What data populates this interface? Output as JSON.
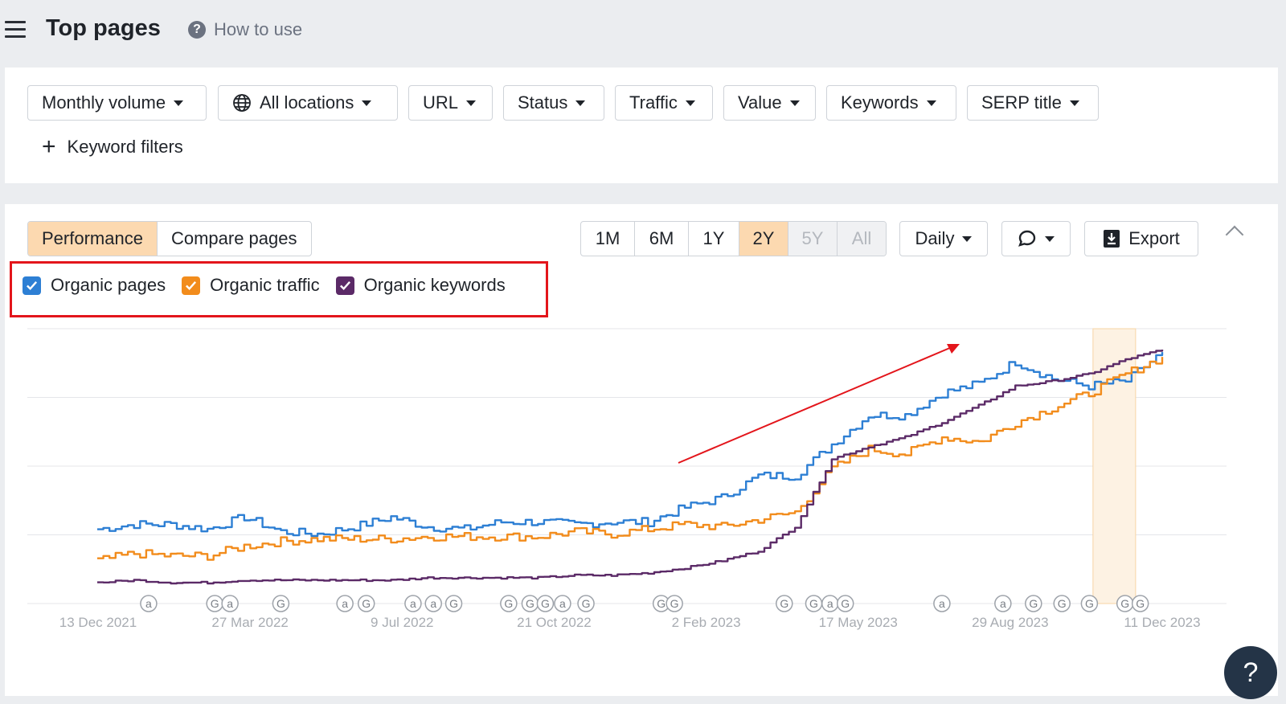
{
  "header": {
    "title": "Top pages",
    "how_to_use": "How to use"
  },
  "filters": {
    "buttons": [
      "Monthly volume",
      "All locations",
      "URL",
      "Status",
      "Traffic",
      "Value",
      "Keywords",
      "SERP title"
    ],
    "keyword_filters": "Keyword filters"
  },
  "chart_controls": {
    "tabs": [
      {
        "label": "Performance",
        "active": true
      },
      {
        "label": "Compare pages",
        "active": false
      }
    ],
    "ranges": [
      {
        "label": "1M",
        "state": "normal"
      },
      {
        "label": "6M",
        "state": "normal"
      },
      {
        "label": "1Y",
        "state": "normal"
      },
      {
        "label": "2Y",
        "state": "active"
      },
      {
        "label": "5Y",
        "state": "disabled"
      },
      {
        "label": "All",
        "state": "disabled"
      }
    ],
    "interval": "Daily",
    "export": "Export"
  },
  "legend": {
    "items": [
      {
        "label": "Organic pages",
        "color": "#2d7fd4",
        "checked": true
      },
      {
        "label": "Organic traffic",
        "color": "#f28c1c",
        "checked": true
      },
      {
        "label": "Organic keywords",
        "color": "#5b2a67",
        "checked": true
      }
    ]
  },
  "chart_data": {
    "type": "line",
    "x_ticks": [
      "13 Dec 2021",
      "27 Mar 2022",
      "9 Jul 2022",
      "21 Oct 2022",
      "2 Feb 2023",
      "17 May 2023",
      "29 Aug 2023",
      "11 Dec 2023"
    ],
    "gridlines": 5,
    "y_axis_labels_visible": false,
    "series": [
      {
        "name": "Organic pages",
        "color": "#2d7fd4",
        "values": [
          24,
          26,
          26,
          24,
          29,
          23,
          22,
          25,
          29,
          25,
          24,
          27,
          27,
          26,
          27,
          27,
          33,
          37,
          46,
          46,
          59,
          71,
          71,
          80,
          84,
          93,
          86,
          83,
          85,
          97
        ]
      },
      {
        "name": "Organic traffic",
        "color": "#f28c1c",
        "values": [
          11,
          14,
          13,
          13,
          17,
          19,
          20,
          20,
          20,
          21,
          21,
          21,
          21,
          23,
          22,
          24,
          26,
          25,
          28,
          31,
          49,
          57,
          55,
          62,
          60,
          68,
          74,
          80,
          88,
          95
        ]
      },
      {
        "name": "Organic keywords",
        "color": "#5b2a67",
        "values": [
          2,
          3,
          2,
          2,
          3,
          3,
          3,
          3,
          3,
          4,
          4,
          4,
          4,
          5,
          5,
          6,
          8,
          11,
          15,
          25,
          53,
          58,
          62,
          68,
          75,
          83,
          85,
          88,
          94,
          98
        ]
      }
    ],
    "event_markers": [
      {
        "x": 0.06,
        "letter": "a"
      },
      {
        "x": 0.125,
        "letter": "G"
      },
      {
        "x": 0.14,
        "letter": "a"
      },
      {
        "x": 0.19,
        "letter": "G"
      },
      {
        "x": 0.253,
        "letter": "a"
      },
      {
        "x": 0.274,
        "letter": "G"
      },
      {
        "x": 0.32,
        "letter": "a"
      },
      {
        "x": 0.34,
        "letter": "a"
      },
      {
        "x": 0.36,
        "letter": "G"
      },
      {
        "x": 0.414,
        "letter": "G"
      },
      {
        "x": 0.435,
        "letter": "G"
      },
      {
        "x": 0.45,
        "letter": "G"
      },
      {
        "x": 0.467,
        "letter": "a"
      },
      {
        "x": 0.49,
        "letter": "G"
      },
      {
        "x": 0.564,
        "letter": "G"
      },
      {
        "x": 0.577,
        "letter": "G"
      },
      {
        "x": 0.685,
        "letter": "G"
      },
      {
        "x": 0.714,
        "letter": "G"
      },
      {
        "x": 0.73,
        "letter": "a"
      },
      {
        "x": 0.745,
        "letter": "G"
      },
      {
        "x": 0.84,
        "letter": "a"
      },
      {
        "x": 0.9,
        "letter": "a"
      },
      {
        "x": 0.93,
        "letter": "G"
      },
      {
        "x": 0.958,
        "letter": "G"
      },
      {
        "x": 0.985,
        "letter": "G"
      },
      {
        "x": 1.02,
        "letter": "G"
      },
      {
        "x": 1.035,
        "letter": "G"
      }
    ],
    "highlight_range": {
      "start_x": 0.935,
      "end_x": 0.975
    }
  }
}
